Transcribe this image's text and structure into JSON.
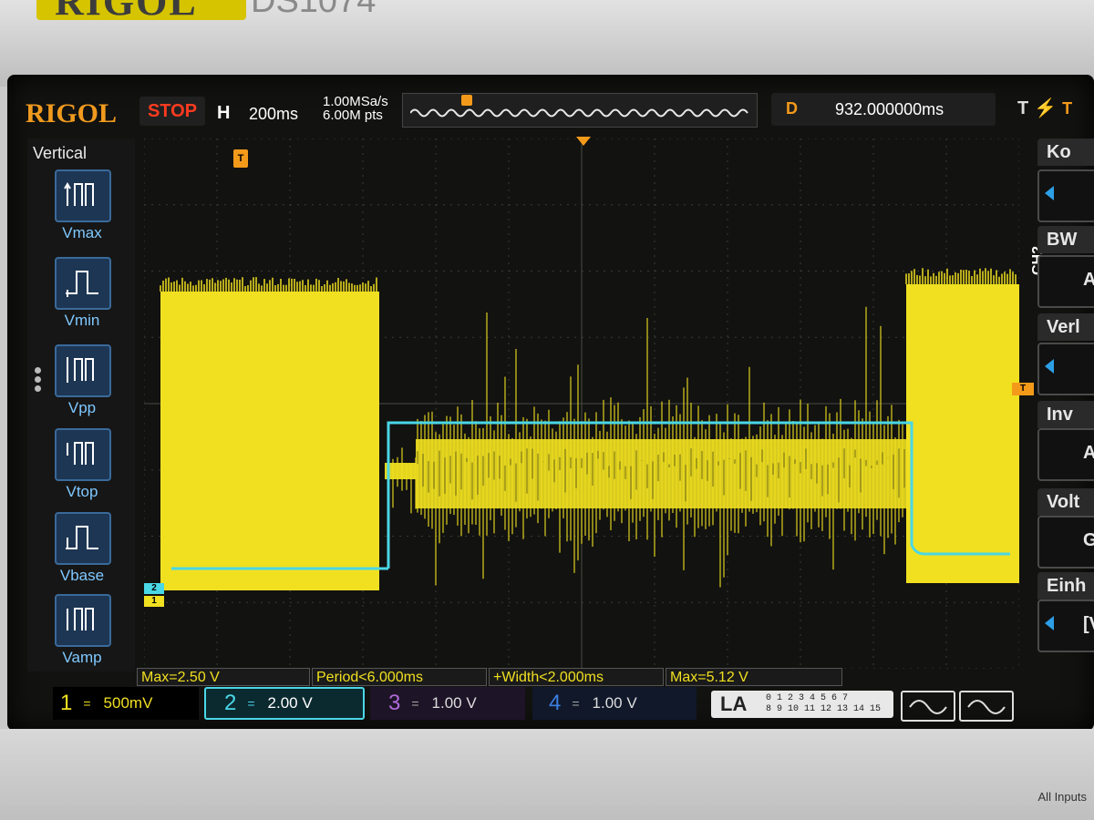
{
  "bezel": {
    "brand": "RIGOL",
    "model": "DS1074",
    "panel_note": "All Inputs"
  },
  "header": {
    "logo": "RIGOL",
    "run_state": "STOP",
    "horizontal_label": "H",
    "timebase": "200ms",
    "sample_rate": "1.00MSa/s",
    "memory_depth": "6.00M pts",
    "delay_label": "D",
    "delay_value": "932.000000ms",
    "trigger_type_label": "T",
    "trigger_slope_icon": "rising-edge-bolt-icon",
    "trigger_source": "T"
  },
  "vertical_menu": {
    "title": "Vertical",
    "items": [
      {
        "label": "Vmax",
        "icon": "vmax-measure-icon"
      },
      {
        "label": "Vmin",
        "icon": "vmin-measure-icon"
      },
      {
        "label": "Vpp",
        "icon": "vpp-measure-icon"
      },
      {
        "label": "Vtop",
        "icon": "vtop-measure-icon"
      },
      {
        "label": "Vbase",
        "icon": "vbase-measure-icon"
      },
      {
        "label": "Vamp",
        "icon": "vamp-measure-icon"
      }
    ],
    "page_dots": 3
  },
  "markers": {
    "ch2": "2",
    "ch1": "1",
    "trigger_pos": "T",
    "trigger_level": "T"
  },
  "right_menu": {
    "side_label": "CH2",
    "items": [
      {
        "tab": "Ko",
        "value": ""
      },
      {
        "tab": "BW",
        "value": "A"
      },
      {
        "tab": "Verl",
        "value": ""
      },
      {
        "tab": "Inv",
        "value": "Au"
      },
      {
        "tab": "Volt",
        "value": "Gr"
      },
      {
        "tab": "Einh",
        "value": "[V"
      }
    ]
  },
  "measurements": [
    "Max=2.50 V",
    "Period<6.000ms",
    "+Width<2.000ms",
    "Max=5.12 V"
  ],
  "channels": [
    {
      "num": "1",
      "coupling": "=",
      "scale": "500mV",
      "color": "#f0e020",
      "active": true
    },
    {
      "num": "2",
      "coupling": "=",
      "scale": "2.00 V",
      "color": "#4ad7e6",
      "active": true
    },
    {
      "num": "3",
      "coupling": "=",
      "scale": "1.00 V",
      "color": "#b06ad8",
      "active": false
    },
    {
      "num": "4",
      "coupling": "=",
      "scale": "1.00 V",
      "color": "#3c7ee0",
      "active": false
    }
  ],
  "la": {
    "label": "LA",
    "row1": "0 1 2 3  4 5 6 7",
    "row2": "8 9 10 11 12 13 14 15"
  },
  "colors": {
    "ch1": "#f0e020",
    "ch2": "#4ad7e6",
    "accent": "#f49a1a",
    "stop": "#ff3b1f"
  }
}
